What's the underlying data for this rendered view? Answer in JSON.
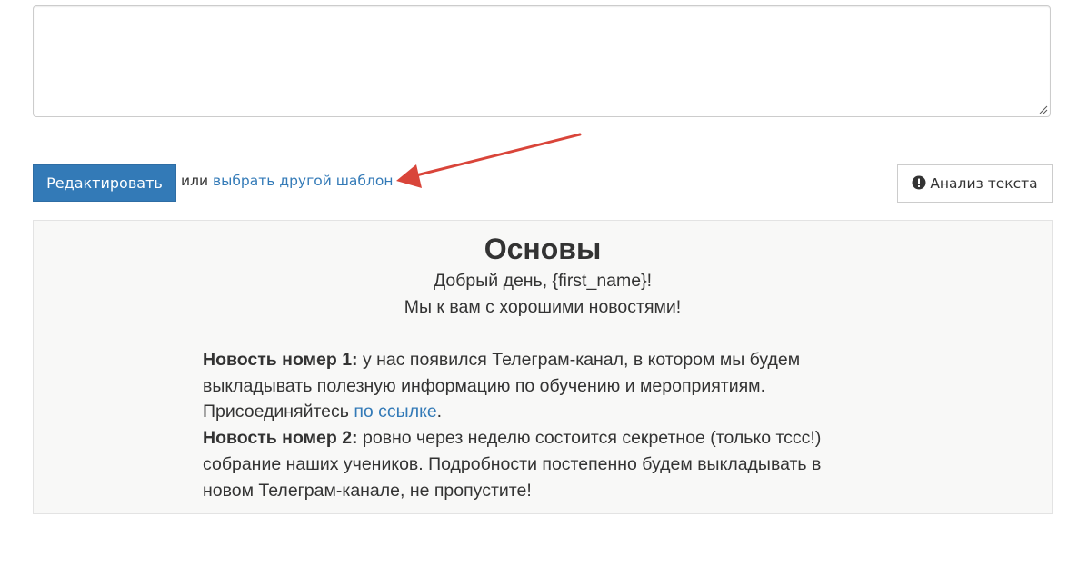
{
  "toolbar": {
    "edit_label": "Редактировать",
    "or_text": "или",
    "choose_template_label": "выбрать другой шаблон",
    "analysis_label": "Анализ текста"
  },
  "colors": {
    "primary": "#337ab7",
    "arrow": "#d9453a",
    "preview_bg": "#f8f8f7"
  },
  "preview": {
    "title": "Основы",
    "greeting": "Добрый день, {first_name}!",
    "subgreeting": "Мы к вам с хорошими новостями!",
    "news1_label": "Новость номер 1:",
    "news1_text_a": "  у нас появился Телеграм-канал, в котором мы будем",
    "news1_text_b": "выкладывать полезную информацию по обучению и мероприятиям.",
    "news1_text_c": "Присоединяйтесь ",
    "news1_link": "по ссылке",
    "news1_text_d": ".",
    "news2_label": "Новость номер 2:",
    "news2_text_a": " ровно через неделю состоится секретное (только тссс!)",
    "news2_text_b": "собрание наших учеников. Подробности постепенно будем выкладывать в",
    "news2_text_c": "новом Телеграм-канале, не пропустите!"
  }
}
